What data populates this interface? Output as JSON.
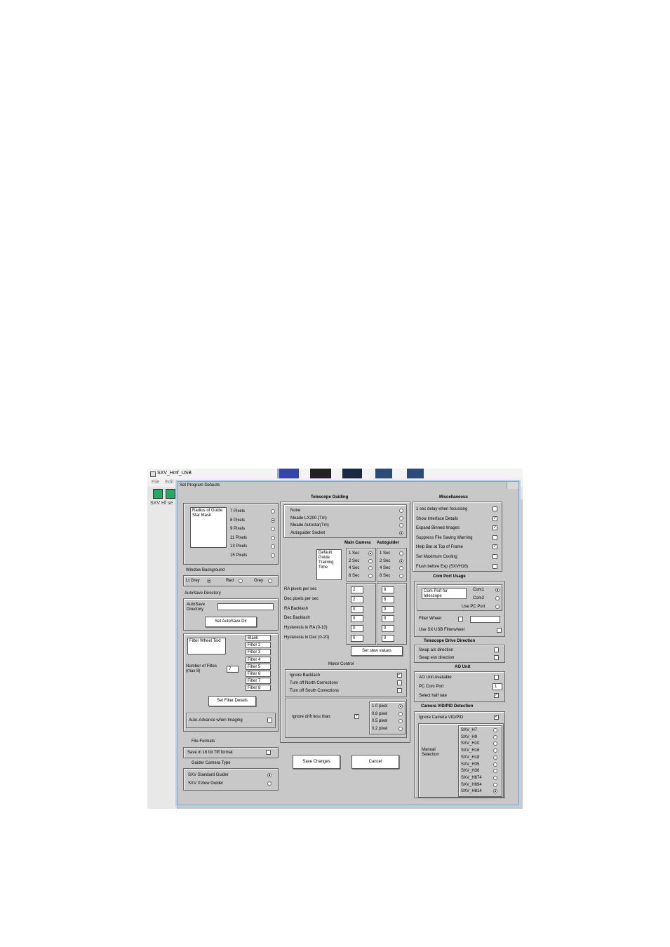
{
  "window": {
    "title": "SXV_Hmf_USB",
    "menu": [
      "File",
      "Edit"
    ],
    "side_label": "SXV Hf se"
  },
  "dialog": {
    "title": "Set Program Defaults",
    "guide_mask": {
      "label": "Radius of Guide Star Mask",
      "options": [
        "7 Pixels",
        "8 Pixels",
        "9 Pixels",
        "11 Pixels",
        "13 Pixels",
        "15 Pixels"
      ],
      "selected": 1
    },
    "window_background": {
      "title": "Window Background",
      "options": [
        "Lt Grey",
        "Red",
        "Grey"
      ],
      "selected": 0
    },
    "autosave": {
      "title": "AutoSave Directory",
      "dir_label": "AutoSave Directory",
      "dir_value": "",
      "button": "Set AutoSave Dir"
    },
    "filters": {
      "text_label": "Filter Wheel Text",
      "number_label": "Number of Filtes (max 8)",
      "number_value": "7",
      "names": [
        "Blank",
        "Filter 2",
        "Filter 3",
        "Filter 4",
        "Filter 5",
        "Filter 6",
        "Filter 7",
        "Filter 8"
      ],
      "button": "Set Filter Details",
      "auto_advance": "Auto-Advance when Imaging",
      "auto_advance_checked": false
    },
    "file_formats": {
      "title": "File Formats",
      "tiff": "Save in 16 bit Tiff format",
      "tiff_checked": false
    },
    "guider_camera": {
      "title": "Guider Camera Type",
      "options": [
        "SXV Standard Guider",
        "SXV XView Guider"
      ],
      "selected": 0
    },
    "telescope_guiding": {
      "title": "Telescope Guiding",
      "mounts": [
        "None",
        "Meade LX200 (Tm)",
        "Meade Autostar(Tm)",
        "Autoguider Socket"
      ],
      "mount_selected": 3,
      "col_main": "Main Camera",
      "col_auto": "Autoguider",
      "training_label": "Default Guide Training Time",
      "times": [
        "1 Sec",
        "2 Sec",
        "4 Sec",
        "8 Sec"
      ],
      "main_selected": 0,
      "auto_selected": 1,
      "params": [
        {
          "label": "RA pixels per sec",
          "main": "2",
          "auto": "6"
        },
        {
          "label": "Dec pixels per sec",
          "main": "2",
          "auto": "6"
        },
        {
          "label": "RA Backlash",
          "main": "0",
          "auto": "0"
        },
        {
          "label": "Dec Backlash",
          "main": "0",
          "auto": "0"
        },
        {
          "label": "Hysteresis in RA (0-10)",
          "main": "0",
          "auto": "0"
        },
        {
          "label": "Hysteresis in Dec (0-20)",
          "main": "0",
          "auto": "0"
        }
      ],
      "slew_button": "Set slew values"
    },
    "motor_control": {
      "title": "Motor Control",
      "items": [
        {
          "label": "Ignore Backlash",
          "checked": true
        },
        {
          "label": "Turn off North Corrections",
          "checked": false
        },
        {
          "label": "Turn off South Corrections",
          "checked": false
        }
      ],
      "ignore_drift": "Ignore drift less than:",
      "ignore_drift_checked": true,
      "drift_options": [
        "1.0 pixel",
        "0.8 pixel",
        "0.5 pixel",
        "0.2 pixel"
      ],
      "drift_selected": 0
    },
    "save_button": "Save Changes",
    "cancel_button": "Cancel",
    "misc": {
      "title": "Miscellaneous",
      "items": [
        {
          "label": "1 sec delay when focussing",
          "checked": false
        },
        {
          "label": "Show Interface Details",
          "checked": true
        },
        {
          "label": "Expand Binned Images",
          "checked": true
        },
        {
          "label": "Suppress File Saving Warning",
          "checked": false
        },
        {
          "label": "Help Bar at Top of Frame",
          "checked": true
        },
        {
          "label": "Set Maximum Cooling",
          "checked": false
        },
        {
          "label": "Flush before Exp (SXVH16)",
          "checked": false
        }
      ]
    },
    "com_port": {
      "title": "Com Port Usage",
      "box_label": "Com Port for telescope",
      "options": [
        "Com1",
        "Com2",
        "Use PC Port"
      ],
      "selected": 0,
      "filter_wheel": "Filter Wheel",
      "filter_wheel_checked": false,
      "filter_wheel_value": "",
      "usb_filter": "Use SX USB Filterwheel",
      "usb_filter_checked": false
    },
    "drive_direction": {
      "title": "Telescope Drive Direction",
      "items": [
        {
          "label": "Swap a/s direction",
          "checked": false
        },
        {
          "label": "Swap e/w direction",
          "checked": false
        }
      ]
    },
    "ao_unit": {
      "title": "AO Unit",
      "available": "AO Unit Available",
      "available_checked": false,
      "pc_port": "PC Com Port",
      "pc_port_value": "1",
      "half_rate": "Select half rate",
      "half_rate_checked": true
    },
    "camera_vid": {
      "title": "Camera VID/PID Detection",
      "ignore": "Ignore Camera VID/PID",
      "ignore_checked": true,
      "manual": "Manual Selection",
      "models": [
        "SXV_H7",
        "SXV_H9",
        "SXV_H10",
        "SXV_H16",
        "SXV_H18",
        "SXV_H35",
        "SXV_H36",
        "SXV_H674",
        "SXV_H694",
        "SXV_H814"
      ],
      "selected": 9
    }
  }
}
